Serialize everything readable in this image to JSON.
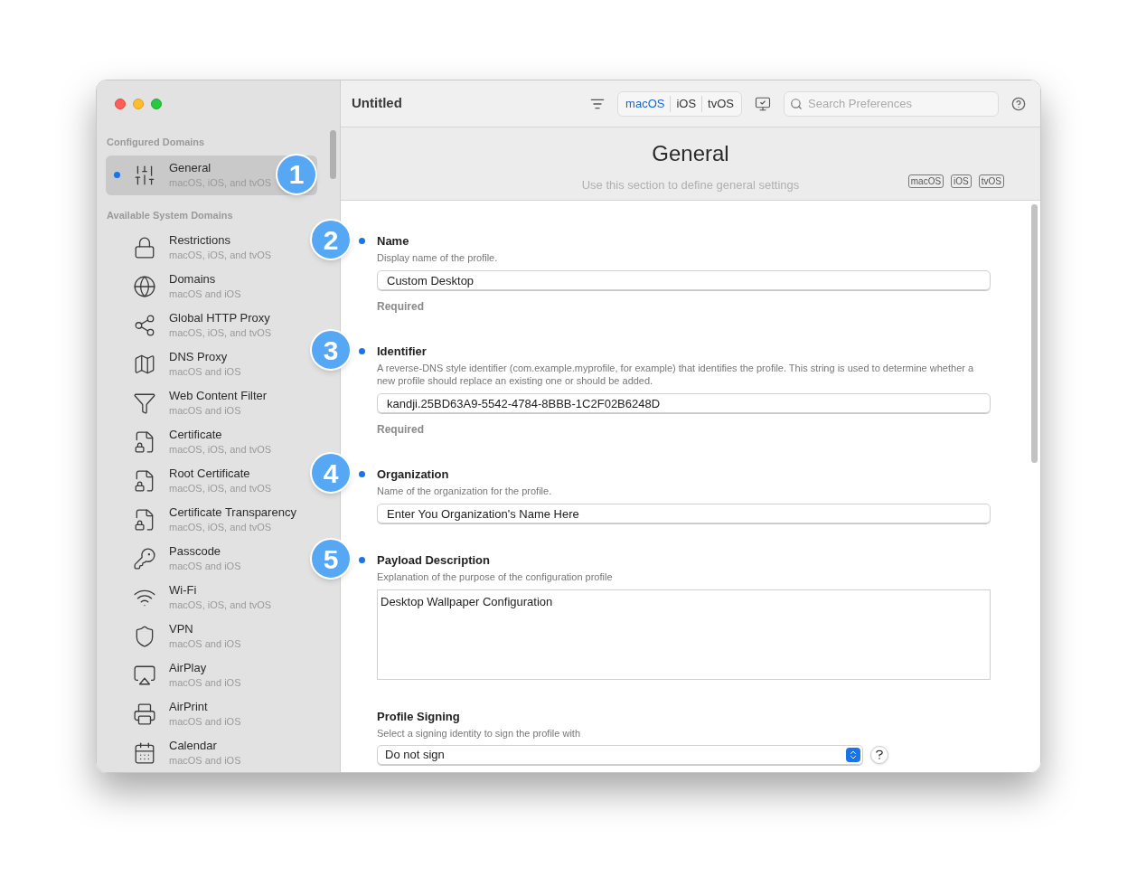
{
  "window": {
    "title": "Untitled"
  },
  "sidebar": {
    "sections": [
      {
        "heading": "Configured Domains",
        "items": [
          {
            "name": "General",
            "platforms": "macOS, iOS, and tvOS",
            "selected": true,
            "configured": true,
            "callout": "1"
          }
        ]
      },
      {
        "heading": "Available System Domains",
        "items": [
          {
            "name": "Restrictions",
            "platforms": "macOS, iOS, and tvOS",
            "selected": false,
            "configured": false
          },
          {
            "name": "Domains",
            "platforms": "macOS and iOS",
            "selected": false,
            "configured": false
          },
          {
            "name": "Global HTTP Proxy",
            "platforms": "macOS, iOS, and tvOS",
            "selected": false,
            "configured": false
          },
          {
            "name": "DNS Proxy",
            "platforms": "macOS and iOS",
            "selected": false,
            "configured": false
          },
          {
            "name": "Web Content Filter",
            "platforms": "macOS and iOS",
            "selected": false,
            "configured": false
          },
          {
            "name": "Certificate",
            "platforms": "macOS, iOS, and tvOS",
            "selected": false,
            "configured": false
          },
          {
            "name": "Root Certificate",
            "platforms": "macOS, iOS, and tvOS",
            "selected": false,
            "configured": false
          },
          {
            "name": "Certificate Transparency",
            "platforms": "macOS, iOS, and tvOS",
            "selected": false,
            "configured": false
          },
          {
            "name": "Passcode",
            "platforms": "macOS and iOS",
            "selected": false,
            "configured": false
          },
          {
            "name": "Wi-Fi",
            "platforms": "macOS, iOS, and tvOS",
            "selected": false,
            "configured": false
          },
          {
            "name": "VPN",
            "platforms": "macOS and iOS",
            "selected": false,
            "configured": false
          },
          {
            "name": "AirPlay",
            "platforms": "macOS and iOS",
            "selected": false,
            "configured": false
          },
          {
            "name": "AirPrint",
            "platforms": "macOS and iOS",
            "selected": false,
            "configured": false
          },
          {
            "name": "Calendar",
            "platforms": "macOS and iOS",
            "selected": false,
            "configured": false
          }
        ]
      }
    ]
  },
  "toolbar": {
    "platforms": [
      {
        "label": "macOS",
        "selected": true
      },
      {
        "label": "iOS",
        "selected": false
      },
      {
        "label": "tvOS",
        "selected": false
      }
    ],
    "search": {
      "placeholder": "Search Preferences"
    }
  },
  "header": {
    "title": "General",
    "subtitle": "Use this section to define general settings",
    "tags": [
      "macOS",
      "iOS",
      "tvOS"
    ]
  },
  "fields": [
    {
      "kind": "text",
      "label": "Name",
      "description": "Display name of the profile.",
      "value": "Custom Desktop",
      "note": "Required",
      "configured": true,
      "callout": "2"
    },
    {
      "kind": "text",
      "label": "Identifier",
      "description": "A reverse-DNS style identifier (com.example.myprofile, for example) that identifies the profile. This string is used to determine whether a new profile should replace an existing one or should be added.",
      "value": "kandji.25BD63A9-5542-4784-8BBB-1C2F02B6248D",
      "note": "Required",
      "configured": true,
      "callout": "3"
    },
    {
      "kind": "text",
      "label": "Organization",
      "description": "Name of the organization for the profile.",
      "value": "Enter You Organization's Name Here",
      "configured": true,
      "callout": "4"
    },
    {
      "kind": "textarea",
      "label": "Payload Description",
      "description": "Explanation of the purpose of the configuration profile",
      "value": "Desktop Wallpaper Configuration",
      "configured": true,
      "callout": "5"
    },
    {
      "kind": "select",
      "label": "Profile Signing",
      "description": "Select a signing identity to sign the profile with",
      "value": "Do not sign",
      "configured": false
    }
  ]
}
